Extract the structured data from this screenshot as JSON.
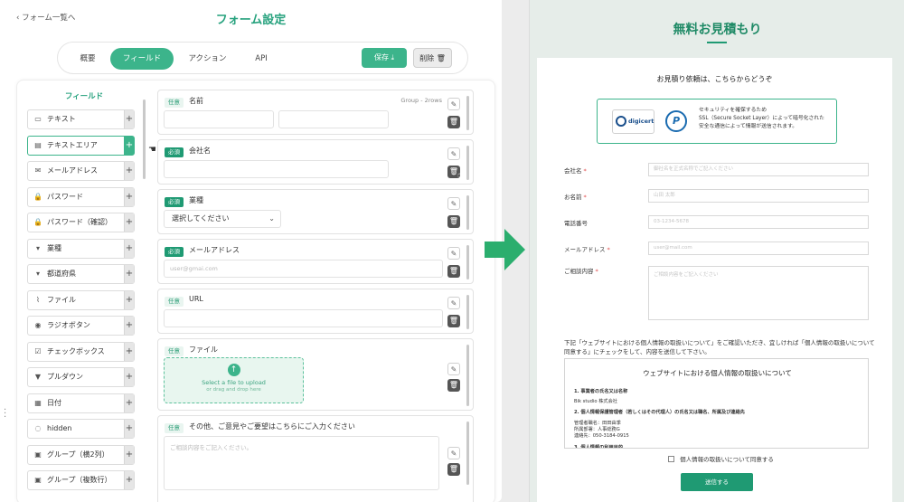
{
  "editor": {
    "back_label": "フォーム一覧へ",
    "title": "フォーム設定",
    "tabs": [
      {
        "label": "概要"
      },
      {
        "label": "フィールド"
      },
      {
        "label": "アクション"
      },
      {
        "label": "API"
      }
    ],
    "active_tab": "フィールド",
    "save_label": "保存",
    "delete_label": "削除",
    "palette_title": "フィールド",
    "palette_items": [
      {
        "label": "テキスト",
        "icon": "text-field-icon"
      },
      {
        "label": "テキストエリア",
        "icon": "textarea-icon"
      },
      {
        "label": "メールアドレス",
        "icon": "mail-icon"
      },
      {
        "label": "パスワード",
        "icon": "lock-icon"
      },
      {
        "label": "パスワード（確認）",
        "icon": "lock-icon"
      },
      {
        "label": "業種",
        "icon": "select-icon"
      },
      {
        "label": "都道府県",
        "icon": "select-icon"
      },
      {
        "label": "ファイル",
        "icon": "paperclip-icon"
      },
      {
        "label": "ラジオボタン",
        "icon": "radio-icon"
      },
      {
        "label": "チェックボックス",
        "icon": "checkbox-icon"
      },
      {
        "label": "プルダウン",
        "icon": "dropdown-icon"
      },
      {
        "label": "日付",
        "icon": "calendar-icon"
      },
      {
        "label": "hidden",
        "icon": "eye-off-icon"
      },
      {
        "label": "グループ（横2列）",
        "icon": "group-icon"
      },
      {
        "label": "グループ（複数行）",
        "icon": "group-icon"
      }
    ],
    "cards": [
      {
        "badge": "任意",
        "label": "名前",
        "hint": "Group - 2rows"
      },
      {
        "badge": "必須",
        "label": "会社名"
      },
      {
        "badge": "必須",
        "label": "業種",
        "select_value": "選択してください"
      },
      {
        "badge": "必須",
        "label": "メールアドレス",
        "placeholder": "user@gmai.com"
      },
      {
        "badge": "任意",
        "label": "URL"
      },
      {
        "badge": "任意",
        "label": "ファイル",
        "upload_title": "Select a file to upload",
        "upload_sub": "or drag and drop here"
      },
      {
        "badge": "任意",
        "label": "その他、ご意見やご要望はこちらにご入力ください",
        "placeholder": "ご相談内容をご記入ください。"
      }
    ]
  },
  "preview": {
    "title": "無料お見積もり",
    "subtitle": "お見積り依頼は、こちらからどうぞ",
    "ssl": {
      "digicert_label": "digicert",
      "pmark_label": "P",
      "text_lines": [
        "セキュリティを確保するため",
        "SSL（Secure Socket Layer）によって暗号化された",
        "安全な通信によって情報が送信されます。"
      ]
    },
    "fields": [
      {
        "label": "会社名",
        "required": true,
        "placeholder": "御社名を正式名称でご記入ください"
      },
      {
        "label": "お名前",
        "required": true,
        "placeholder": "山田 太郎"
      },
      {
        "label": "電話番号",
        "required": false,
        "placeholder": "03-1234-5678"
      },
      {
        "label": "メールアドレス",
        "required": true,
        "placeholder": "user@mail.com"
      },
      {
        "label": "ご相談内容",
        "required": true,
        "placeholder": "ご相談内容をご記入ください"
      }
    ],
    "agree_text": "下記「ウェブサイトにおける個人情報の取扱いについて」をご確認いただき、宜しければ「個人情報の取扱いについて同意する」にチェックをして、内容を送信して下さい。",
    "policy": {
      "title": "ウェブサイトにおける個人情報の取扱いについて",
      "lines": [
        {
          "text": "1. 事業者の氏名又は名称",
          "heading": true
        },
        {
          "text": "Bik studio 株式会社",
          "heading": false
        },
        {
          "text": "2. 個人情報保護管理者（若しくはその代理人）の氏名又は職名、所属及び連絡先",
          "heading": true
        },
        {
          "text": "管理者職名：田田由季",
          "heading": false
        },
        {
          "text": "所属部署：人事総務G",
          "heading": false
        },
        {
          "text": "連絡先：050-3184-0915",
          "heading": false
        },
        {
          "text": "3. 個人情報の利用目的",
          "heading": true
        }
      ]
    },
    "consent_label": "個人情報の取扱いについて同意する",
    "submit_label": "送信する"
  },
  "colors": {
    "accent": "#3cb48b",
    "accent_dark": "#1f9a73",
    "preview_bg": "#e6ede9",
    "arrow": "#2bae6e"
  }
}
